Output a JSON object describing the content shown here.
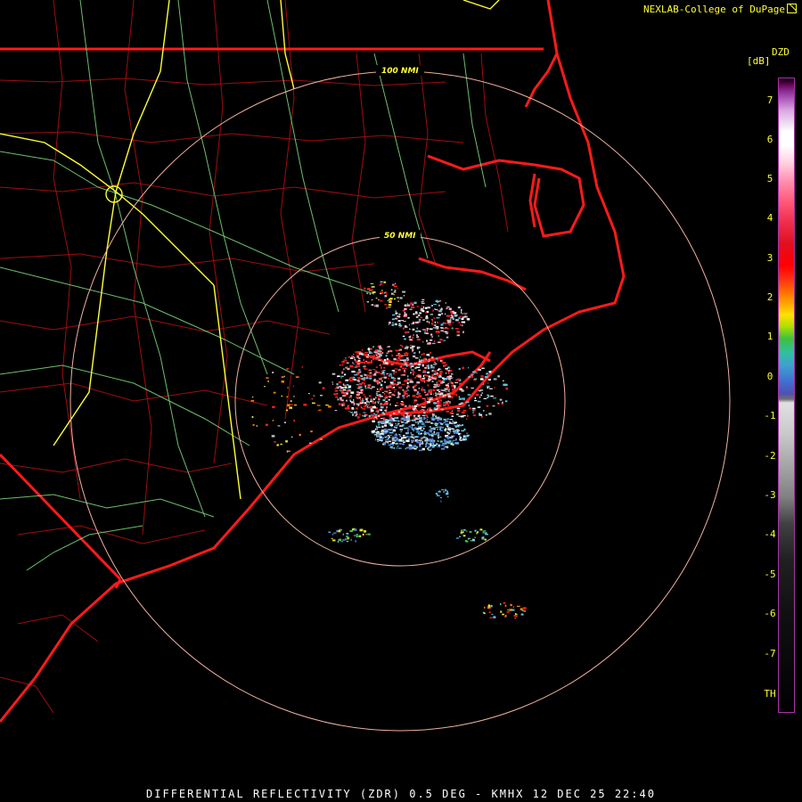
{
  "credit": "NEXLAB-College of DuPage",
  "footer": "DIFFERENTIAL REFLECTIVITY (ZDR) 0.5 DEG - KMHX 12 DEC 25 22:40",
  "colorbar": {
    "title": "DZD",
    "unit": "[dB]",
    "ticks": [
      "7",
      "6",
      "5",
      "4",
      "3",
      "2",
      "1",
      "0",
      "-1",
      "-2",
      "-3",
      "-4",
      "-5",
      "-6",
      "-7",
      "TH"
    ]
  },
  "range_rings": [
    "100 NMI",
    "50 NMI"
  ],
  "colors": {
    "text": "#ffff33",
    "state_borders": "#ff1a1a",
    "county_lines": "#c01010",
    "highways": "#80e080",
    "interstates": "#ffff33",
    "rings": "#f0b0a0"
  },
  "radar": {
    "site": "KMHX",
    "product": "ZDR",
    "elevation_deg": 0.5
  }
}
